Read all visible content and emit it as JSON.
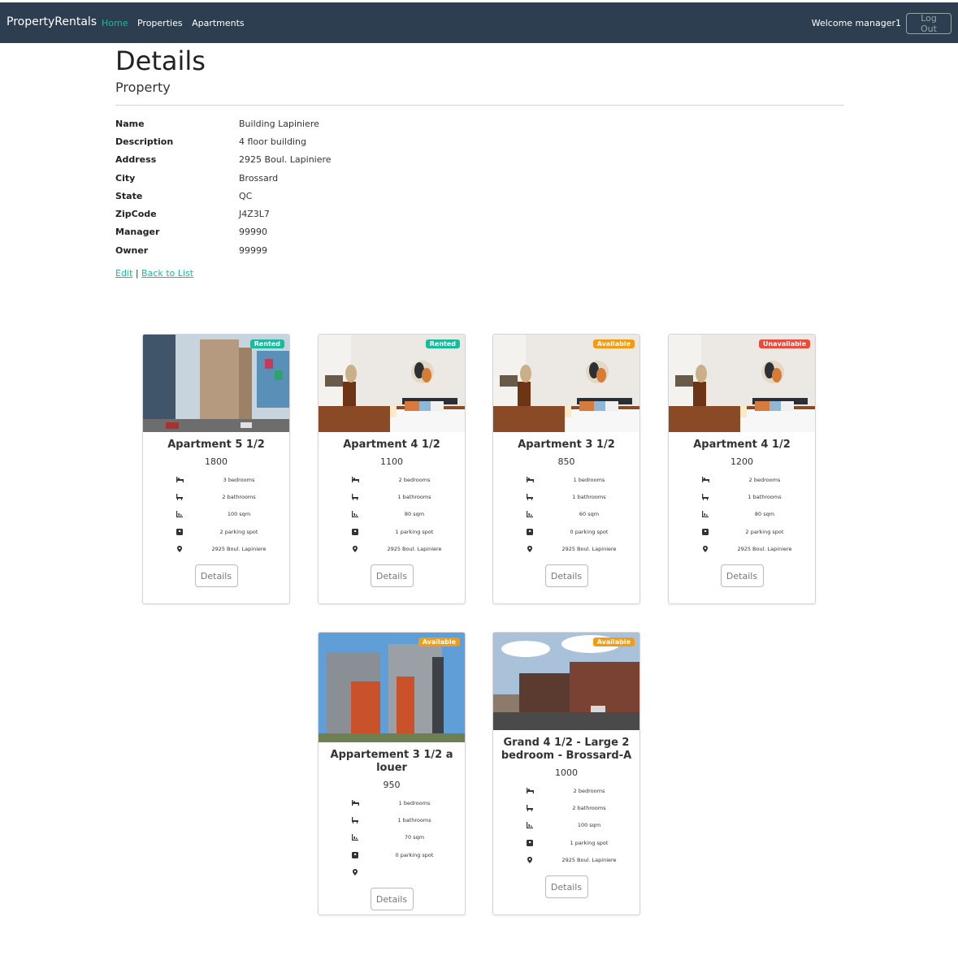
{
  "navbar": {
    "brand": "PropertyRentals",
    "links": [
      "Home",
      "Properties",
      "Apartments"
    ],
    "welcome": "Welcome manager1",
    "logout": "Log Out"
  },
  "page": {
    "title": "Details",
    "subtitle": "Property"
  },
  "details": [
    {
      "label": "Name",
      "value": "Building Lapiniere"
    },
    {
      "label": "Description",
      "value": "4 floor building"
    },
    {
      "label": "Address",
      "value": "2925 Boul. Lapiniere"
    },
    {
      "label": "City",
      "value": "Brossard"
    },
    {
      "label": "State",
      "value": "QC"
    },
    {
      "label": "ZipCode",
      "value": "J4Z3L7"
    },
    {
      "label": "Manager",
      "value": "99990"
    },
    {
      "label": "Owner",
      "value": "99999"
    }
  ],
  "actions": {
    "edit": "Edit",
    "separator": "|",
    "back": "Back to List"
  },
  "feature_icons": [
    "bed-icon",
    "bath-icon",
    "area-icon",
    "parking-icon",
    "location-pin-icon"
  ],
  "status_colors": {
    "Rented": "#18bc9c",
    "Available": "#f39c12",
    "Unavailable": "#e74c3c"
  },
  "cards": [
    {
      "title": "Apartment 5 1/2",
      "price": "1800",
      "status": "Rented",
      "photo": "tower-icon",
      "features": [
        "3 bedrooms",
        "2 bathrooms",
        "100 sqm",
        "2 parking spot",
        "2925 Boul. Lapiniere"
      ],
      "button": "Details"
    },
    {
      "title": "Apartment 4 1/2",
      "price": "1100",
      "status": "Rented",
      "photo": "bedroom-icon",
      "features": [
        "2 bedrooms",
        "1 bathrooms",
        "80 sqm",
        "1 parking spot",
        "2925 Boul. Lapiniere"
      ],
      "button": "Details"
    },
    {
      "title": "Apartment 3 1/2",
      "price": "850",
      "status": "Available",
      "photo": "bedroom-icon",
      "features": [
        "1 bedrooms",
        "1 bathrooms",
        "60 sqm",
        "0 parking spot",
        "2925 Boul. Lapiniere"
      ],
      "button": "Details"
    },
    {
      "title": "Apartment 4 1/2",
      "price": "1200",
      "status": "Unavailable",
      "photo": "bedroom-icon",
      "features": [
        "2 bedrooms",
        "1 bathrooms",
        "80 sqm",
        "2 parking spot",
        "2925 Boul. Lapiniere"
      ],
      "button": "Details"
    },
    {
      "title": "Appartement 3 1/2 a louer",
      "price": "950",
      "status": "Available",
      "photo": "highrise-icon",
      "features": [
        "1 bedrooms",
        "1 bathrooms",
        "70 sqm",
        "0 parking spot",
        ""
      ],
      "button": "Details"
    },
    {
      "title": "Grand 4 1/2 - Large 2 bedroom - Brossard-A",
      "price": "1000",
      "status": "Available",
      "photo": "brick-building-icon",
      "features": [
        "2 bedrooms",
        "2 bathrooms",
        "100 sqm",
        "1 parking spot",
        "2925 Boul. Lapiniere"
      ],
      "button": "Details"
    }
  ]
}
